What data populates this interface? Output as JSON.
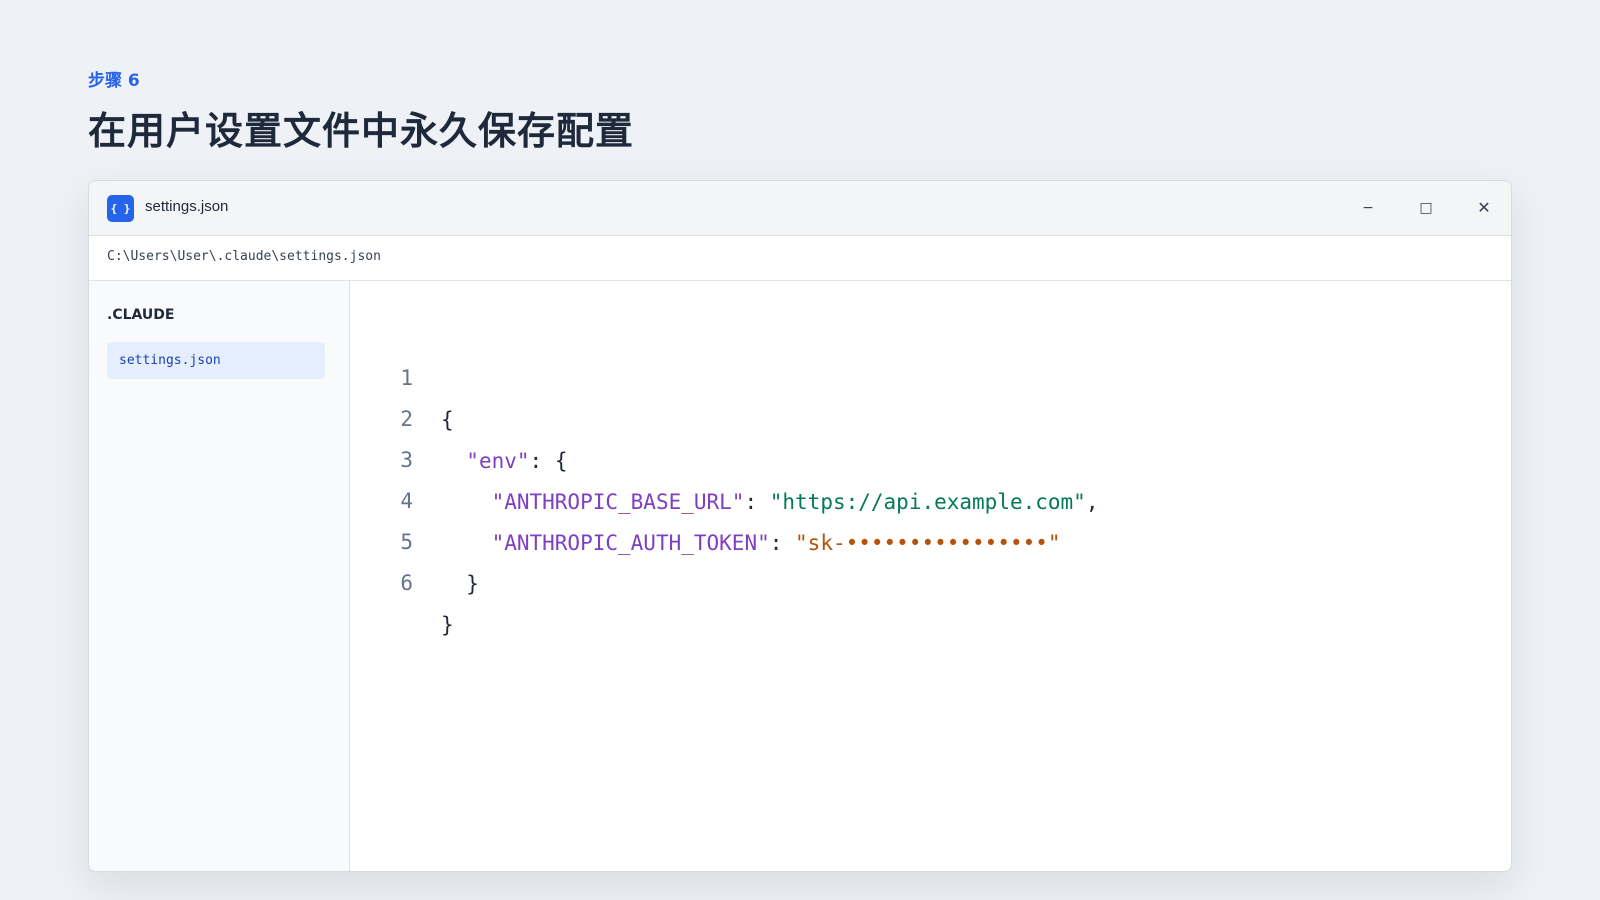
{
  "header": {
    "step_label": "步骤 6",
    "title": "在用户设置文件中永久保存配置"
  },
  "window": {
    "icon_text": "{ }",
    "title": "settings.json",
    "controls": {
      "minimize": "−",
      "maximize": "□",
      "close": "✕"
    }
  },
  "pathbar": {
    "path": "C:\\Users\\User\\.claude\\settings.json"
  },
  "sidebar": {
    "heading": ".CLAUDE",
    "items": [
      {
        "label": "settings.json",
        "selected": true
      }
    ]
  },
  "editor": {
    "lines": [
      {
        "num": "1",
        "indent": "",
        "parts": [
          {
            "text": "{"
          }
        ]
      },
      {
        "num": "2",
        "indent": "  ",
        "key": "\"env\"",
        "sep": ": ",
        "open": "{"
      },
      {
        "num": "3",
        "indent": "    ",
        "key": "\"ANTHROPIC_BASE_URL\"",
        "sep": ": ",
        "value": "\"https://api.example.com\"",
        "trail": ","
      },
      {
        "num": "4",
        "indent": "    ",
        "key": "\"ANTHROPIC_AUTH_TOKEN\"",
        "sep": ": ",
        "value": "\"sk-••••••••••••••••\"",
        "trail": ""
      },
      {
        "num": "5",
        "indent": "  ",
        "parts": [
          {
            "text": "}"
          }
        ]
      },
      {
        "num": "6",
        "indent": "",
        "parts": [
          {
            "text": "}"
          }
        ]
      }
    ]
  },
  "colors": {
    "accent": "#2563eb",
    "key": "#7e3fc0",
    "url_string": "#047857",
    "token_string": "#b45309"
  },
  "icons": {
    "app": "json-braces-icon",
    "minimize": "minimize-icon",
    "maximize": "maximize-icon",
    "close": "close-icon"
  }
}
